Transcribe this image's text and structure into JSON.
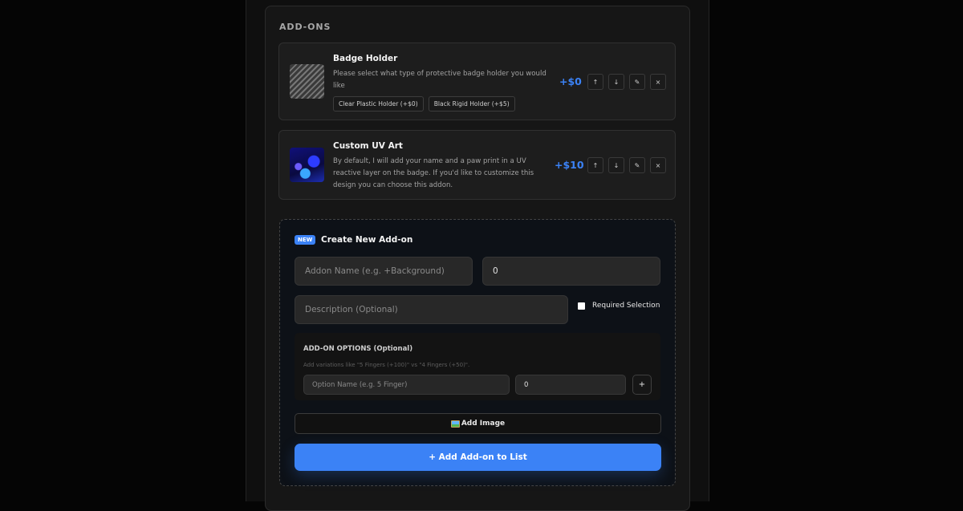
{
  "section": {
    "title": "ADD-ONS"
  },
  "addons": [
    {
      "name": "Badge Holder",
      "description": "Please select what type of protective badge holder you would like",
      "price": "+$0",
      "options": [
        "Clear Plastic Holder (+$0)",
        "Black Rigid Holder (+$5)"
      ]
    },
    {
      "name": "Custom UV Art",
      "description": "By default, I will add your name and a paw print in a UV reactive layer on the badge. If you'd like to customize this design you can choose this addon.",
      "price": "+$10"
    }
  ],
  "controls": {
    "up": "↑",
    "down": "↓",
    "edit": "✎",
    "remove": "×"
  },
  "create": {
    "badge": "NEW",
    "title": "Create New Add-on",
    "name_placeholder": "Addon Name (e.g. +Background)",
    "price_value": "0",
    "description_placeholder": "Description (Optional)",
    "required_label": "Required Selection",
    "options_title": "ADD-ON OPTIONS (Optional)",
    "options_hint": "Add variations like \"5 Fingers (+100)\" vs \"4 Fingers (+50)\".",
    "option_name_placeholder": "Option Name (e.g. 5 Finger)",
    "option_price_value": "0",
    "option_add_label": "+",
    "add_image_label": "Add Image",
    "submit_label": "+ Add Add-on to List"
  },
  "icons": {
    "badge_thumb": "badge-holder-image",
    "uv_thumb": "uv-art-image",
    "add_image": "picture-icon"
  },
  "colors": {
    "accent": "#3b82f6",
    "background": "#050505",
    "card": "#161616"
  }
}
